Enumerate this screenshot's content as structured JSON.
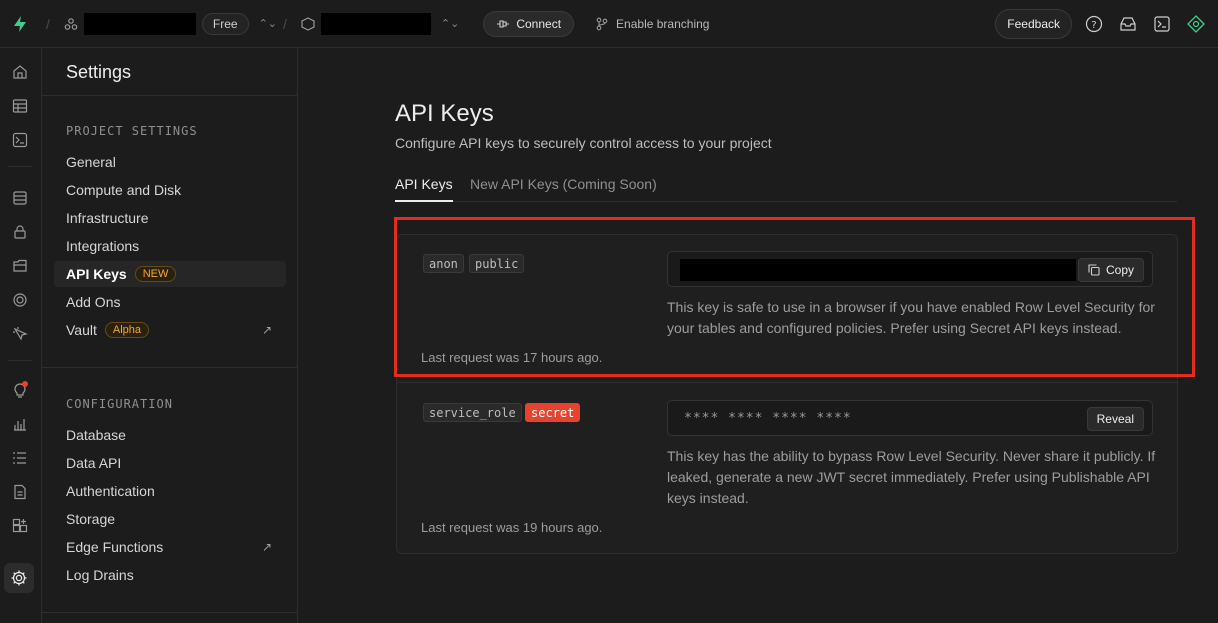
{
  "topbar": {
    "plan_badge": "Free",
    "connect_label": "Connect",
    "branching_label": "Enable branching",
    "feedback_label": "Feedback"
  },
  "sidebar": {
    "title": "Settings",
    "project_section": "PROJECT SETTINGS",
    "project_items": [
      {
        "label": "General"
      },
      {
        "label": "Compute and Disk"
      },
      {
        "label": "Infrastructure"
      },
      {
        "label": "Integrations"
      },
      {
        "label": "API Keys",
        "tag": "NEW",
        "active": true
      },
      {
        "label": "Add Ons"
      },
      {
        "label": "Vault",
        "tag": "Alpha",
        "external": true
      }
    ],
    "config_section": "CONFIGURATION",
    "config_items": [
      {
        "label": "Database"
      },
      {
        "label": "Data API"
      },
      {
        "label": "Authentication"
      },
      {
        "label": "Storage"
      },
      {
        "label": "Edge Functions",
        "external": true
      },
      {
        "label": "Log Drains"
      }
    ]
  },
  "main": {
    "title": "API Keys",
    "subtitle": "Configure API keys to securely control access to your project",
    "tabs": [
      {
        "label": "API Keys",
        "active": true
      },
      {
        "label": "New API Keys (Coming Soon)",
        "active": false
      }
    ],
    "keys": [
      {
        "chips": [
          "anon",
          "public"
        ],
        "button": "Copy",
        "description": "This key is safe to use in a browser if you have enabled Row Level Security for your tables and configured policies. Prefer using Secret API keys instead.",
        "last_request": "Last request was 17 hours ago."
      },
      {
        "chips": [
          "service_role",
          "secret"
        ],
        "masked_value": "**** **** **** ****",
        "button": "Reveal",
        "description": "This key has the ability to bypass Row Level Security. Never share it publicly. If leaked, generate a new JWT secret immediately. Prefer using Publishable API keys instead.",
        "last_request": "Last request was 19 hours ago."
      }
    ]
  },
  "colors": {
    "brand": "#3ecf8e",
    "accent_tag": "#f5a623",
    "secret": "#e5432d",
    "highlight": "#e22c1e"
  }
}
